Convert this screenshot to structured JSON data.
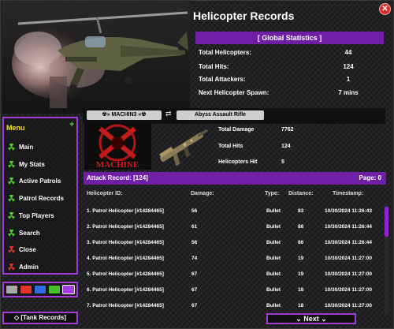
{
  "window": {
    "title": "Helicopter Records",
    "close_glyph": "✕"
  },
  "global_stats": {
    "heading": "[ Global Statistics ]",
    "rows": [
      {
        "label": "Total Helicopters:",
        "value": "44"
      },
      {
        "label": "Total Hits:",
        "value": "124"
      },
      {
        "label": "Total Attackers:",
        "value": "1"
      },
      {
        "label": "Next Helicopter Spawn:",
        "value": "7 mins"
      }
    ]
  },
  "menu": {
    "title": "Menu",
    "add_glyph": "+",
    "items": [
      {
        "label": "Main",
        "icon": "radiation-icon",
        "color": "#4fd12e"
      },
      {
        "label": "My Stats",
        "icon": "radiation-icon",
        "color": "#4fd12e"
      },
      {
        "label": "Active Patrols",
        "icon": "radiation-icon",
        "color": "#4fd12e"
      },
      {
        "label": "Patrol Records",
        "icon": "radiation-icon",
        "color": "#4fd12e"
      },
      {
        "label": "Top Players",
        "icon": "radiation-icon",
        "color": "#4fd12e"
      },
      {
        "label": "Search",
        "icon": "radiation-icon",
        "color": "#4fd12e"
      },
      {
        "label": "Close",
        "icon": "radiation-icon",
        "color": "#e0342c"
      },
      {
        "label": "Admin",
        "icon": "radiation-icon",
        "color": "#e0342c"
      }
    ]
  },
  "color_swatches": [
    "#a8a8a8",
    "#e0342c",
    "#2f6fe3",
    "#45c229",
    "#a63ee0"
  ],
  "tank_button": "◇ [Tank Records]",
  "player": {
    "name": "☢» MACHIN3 «☢",
    "swap_glyph": "⇄",
    "weapon": "Abyss Assault Rifle",
    "logo_text": "MACHINE",
    "stats": [
      {
        "label": "Total Damage",
        "value": "7762"
      },
      {
        "label": "Total Hits",
        "value": "124"
      },
      {
        "label": "Helicopters Hit",
        "value": "5"
      }
    ]
  },
  "attack_record": {
    "title": "Attack Record: [124]",
    "page": "Page: 0",
    "columns": [
      "Helicopter ID:",
      "Damage:",
      "Type:",
      "Distance:",
      "Timestamp:"
    ],
    "rows": [
      {
        "id": "1. Patrol Helicopter [#14284465]",
        "damage": "56",
        "type": "Bullet",
        "distance": "83",
        "time": "10/30/2024 11:26:43"
      },
      {
        "id": "2. Patrol Helicopter [#14284465]",
        "damage": "61",
        "type": "Bullet",
        "distance": "88",
        "time": "10/30/2024 11:26:44"
      },
      {
        "id": "3. Patrol Helicopter [#14284465]",
        "damage": "56",
        "type": "Bullet",
        "distance": "86",
        "time": "10/30/2024 11:26:44"
      },
      {
        "id": "4. Patrol Helicopter [#14284465]",
        "damage": "74",
        "type": "Bullet",
        "distance": "19",
        "time": "10/30/2024 11:27:00"
      },
      {
        "id": "5. Patrol Helicopter [#14284465]",
        "damage": "67",
        "type": "Bullet",
        "distance": "19",
        "time": "10/30/2024 11:27:00"
      },
      {
        "id": "6. Patrol Helicopter [#14284465]",
        "damage": "67",
        "type": "Bullet",
        "distance": "18",
        "time": "10/30/2024 11:27:00"
      },
      {
        "id": "7. Patrol Helicopter [#14284465]",
        "damage": "67",
        "type": "Bullet",
        "distance": "18",
        "time": "10/30/2024 11:27:00"
      }
    ]
  },
  "next_button": "⌄ Next ⌄"
}
